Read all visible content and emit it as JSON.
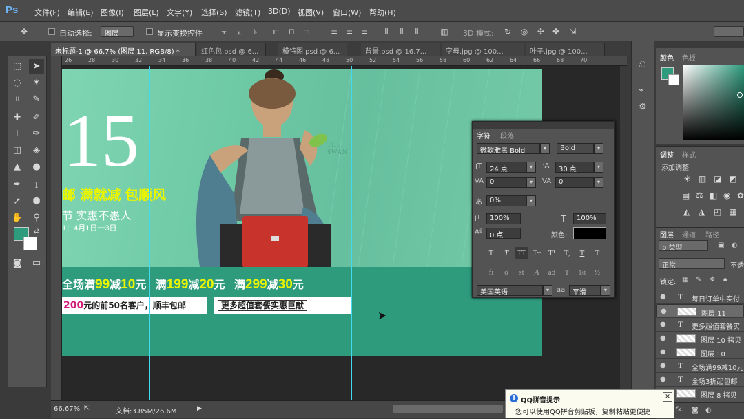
{
  "app": {
    "logo": "Ps"
  },
  "menu": [
    "文件(F)",
    "编辑(E)",
    "图像(I)",
    "图层(L)",
    "文字(Y)",
    "选择(S)",
    "滤镜(T)",
    "3D(D)",
    "视图(V)",
    "窗口(W)",
    "帮助(H)"
  ],
  "options": {
    "auto_select_label": "自动选择:",
    "auto_select_value": "图层",
    "show_transform_label": "显示变换控件",
    "mode_3d_label": "3D 模式:"
  },
  "tabs": [
    {
      "label": "未标题-1 @ 66.7% (图层 11, RGB/8) *",
      "active": true
    },
    {
      "label": "红色包.psd @ 6...",
      "active": false
    },
    {
      "label": "模特图.psd @ 6...",
      "active": false
    },
    {
      "label": "背景.psd @ 16.7...",
      "active": false
    },
    {
      "label": "字母.jpg @ 100...",
      "active": false
    },
    {
      "label": "叶子.jpg @ 100...",
      "active": false
    }
  ],
  "ruler_top": [
    "26",
    "28",
    "30",
    "32",
    "34",
    "36",
    "38",
    "40",
    "42",
    "44",
    "46",
    "48",
    "50",
    "52",
    "54",
    "56",
    "58",
    "60",
    "62",
    "64",
    "66",
    "68",
    "70"
  ],
  "artwork": {
    "big_number": "15",
    "line1": "邮 满就减 包顺风",
    "line2": "节 实惠不愚人",
    "line3": "1：4月1日一3日",
    "brand_text": "THE\nSWAN",
    "promo": [
      {
        "a": "全场满",
        "b": "99",
        "c": "减",
        "d": "10",
        "e": "元"
      },
      {
        "a": "满",
        "b": "199",
        "c": "减",
        "d": "20",
        "e": "元"
      },
      {
        "a": "满",
        "b": "299",
        "c": "减",
        "d": "30",
        "e": "元"
      }
    ],
    "box1_num": "200",
    "box1_text": "元的前50名客户，顺丰包邮",
    "box2_text": "更多超值套餐实惠巨献"
  },
  "character_panel": {
    "tab_char": "字符",
    "tab_para": "段落",
    "font_family": "微软雅黑 Bold",
    "font_style": "Bold",
    "size": "24 点",
    "leading": "30 点",
    "kerning": "0",
    "tracking": "0",
    "scale_pct": "0%",
    "vscale": "100%",
    "hscale": "100%",
    "baseline": "0 点",
    "color_label": "颜色:",
    "color": "#000000",
    "language": "美国英语",
    "aa_label": "aa",
    "antialias": "平滑",
    "style_buttons": [
      "T",
      "T",
      "TT",
      "Tт",
      "T¹",
      "T,",
      "T",
      "Ŧ"
    ],
    "ot_buttons": [
      "fi",
      "ơ",
      "st",
      "A",
      "ad",
      "T",
      "1st",
      "½"
    ]
  },
  "status": {
    "zoom": "66.67%",
    "doc": "文档:3.85M/26.6M"
  },
  "color_panel": {
    "tab_color": "颜色",
    "tab_swatch": "色板",
    "fg": "#2e9b7d",
    "bg": "#ffffff"
  },
  "adjust_panel": {
    "tab_adjust": "调整",
    "tab_style": "样式",
    "add_label": "添加调整"
  },
  "layers_panel": {
    "tab_layers": "图层",
    "tab_channels": "通道",
    "tab_paths": "路径",
    "filter": "ρ 类型",
    "blend": "正常",
    "opacity_label": "不透",
    "lock_label": "锁定:",
    "rows": [
      {
        "type": "text",
        "name": "每日订单中实付",
        "selected": false
      },
      {
        "type": "image",
        "name": "图层 11",
        "selected": true
      },
      {
        "type": "text",
        "name": "更多超值套餐实",
        "selected": false
      },
      {
        "type": "image",
        "name": "图层 10 拷贝",
        "selected": false
      },
      {
        "type": "image",
        "name": "图层 10",
        "selected": false
      },
      {
        "type": "text",
        "name": "全场满99减10元",
        "selected": false
      },
      {
        "type": "text",
        "name": "全场3折起包邮",
        "selected": false
      },
      {
        "type": "image",
        "name": "图层 8 拷贝",
        "selected": false
      }
    ]
  },
  "qq_tip": {
    "title": "QQ拼音提示",
    "body": "您可以使用QQ拼音剪贴板，复制粘贴更便捷",
    "close": "✕"
  }
}
